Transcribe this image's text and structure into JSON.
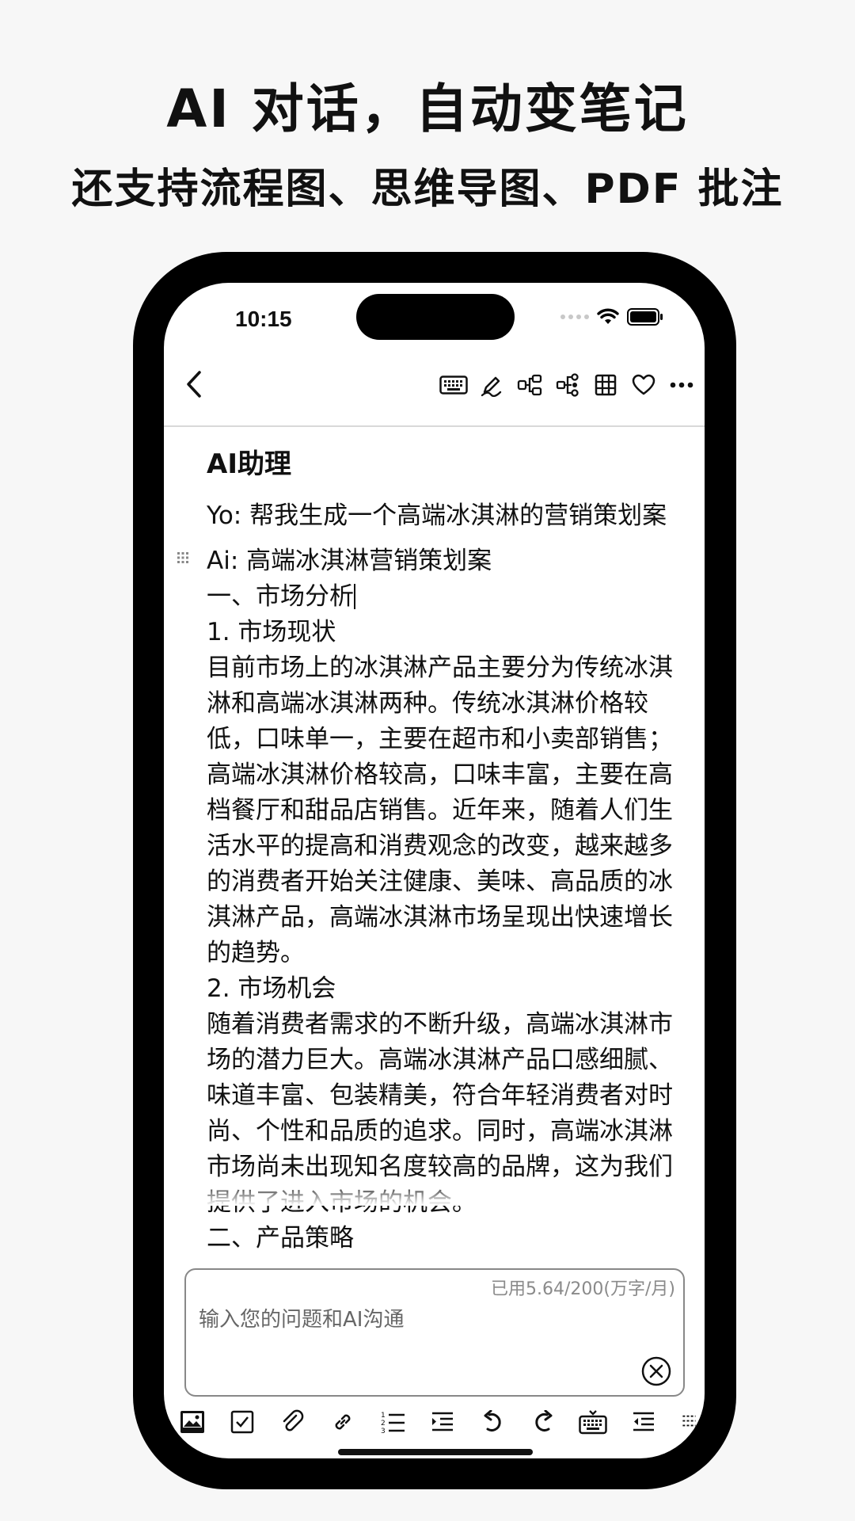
{
  "promo": {
    "headline": "AI 对话，自动变笔记",
    "subheadline": "还支持流程图、思维导图、PDF 批注"
  },
  "status_bar": {
    "time": "10:15"
  },
  "toolbar": {
    "icons": [
      "back-icon",
      "keyboard-icon",
      "pen-icon",
      "flowchart-icon",
      "mindmap-icon",
      "table-icon",
      "heart-icon",
      "more-icon"
    ]
  },
  "note": {
    "title": "AI助理",
    "question": "Yo: 帮我生成一个高端冰淇淋的营销策划案",
    "answer_lines": {
      "l1": "Ai: 高端冰淇淋营销策划案",
      "l2": "一、市场分析",
      "l3": "1. 市场现状",
      "l4": "目前市场上的冰淇淋产品主要分为传统冰淇淋和高端冰淇淋两种。传统冰淇淋价格较低，口味单一，主要在超市和小卖部销售；高端冰淇淋价格较高，口味丰富，主要在高档餐厅和甜品店销售。近年来，随着人们生活水平的提高和消费观念的改变，越来越多的消费者开始关注健康、美味、高品质的冰淇淋产品，高端冰淇淋市场呈现出快速增长的趋势。",
      "l5": "2. 市场机会",
      "l6": "随着消费者需求的不断升级，高端冰淇淋市场的潜力巨大。高端冰淇淋产品口感细腻、味道丰富、包装精美，符合年轻消费者对时尚、个性和品质的追求。同时，高端冰淇淋市场尚未出现知名度较高的品牌，这为我们提供了进入市场的机会。",
      "l7": "二、产品策略"
    }
  },
  "ai_input": {
    "usage": "已用5.64/200(万字/月)",
    "placeholder": "输入您的问题和AI沟通"
  },
  "bottom_toolbar": {
    "icons": [
      "image-icon",
      "checkbox-icon",
      "attachment-icon",
      "link-icon",
      "numbered-list-icon",
      "indent-icon",
      "undo-icon",
      "redo-icon",
      "hide-keyboard-icon",
      "outdent-icon",
      "more-format-icon"
    ]
  }
}
